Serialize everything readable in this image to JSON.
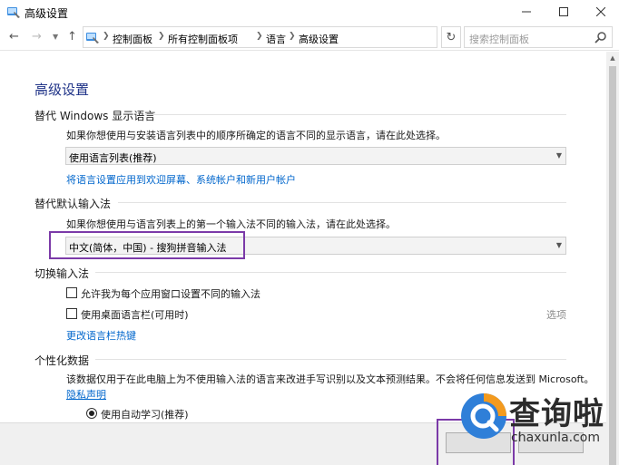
{
  "window": {
    "title": "高级设置",
    "icons": {
      "app": "control-panel-icon",
      "minimize": "minimize-icon",
      "maximize": "maximize-icon",
      "close": "close-icon"
    }
  },
  "address_bar": {
    "breadcrumbs": [
      "控制面板",
      "所有控制面板项",
      "语言",
      "高级设置"
    ],
    "search_placeholder": "搜索控制面板",
    "icons": {
      "back": "back-arrow-icon",
      "forward": "forward-arrow-icon",
      "up": "up-arrow-icon",
      "refresh": "refresh-icon",
      "search": "search-icon"
    }
  },
  "main": {
    "title": "高级设置",
    "display_language": {
      "heading": "替代 Windows 显示语言",
      "description": "如果你想使用与安装语言列表中的顺序所确定的语言不同的显示语言，请在此处选择。",
      "selected": "使用语言列表(推荐)",
      "link": "将语言设置应用到欢迎屏幕、系统帐户和新用户帐户"
    },
    "input_method": {
      "heading": "替代默认输入法",
      "description": "如果你想使用与语言列表上的第一个输入法不同的输入法，请在此处选择。",
      "selected": "中文(简体，中国) - 搜狗拼音输入法"
    },
    "switch_input": {
      "heading": "切换输入法",
      "option1": "允许我为每个应用窗口设置不同的输入法",
      "option2": "使用桌面语言栏(可用时)",
      "options_link": "选项",
      "hotkeys_link": "更改语言栏热键"
    },
    "personalization": {
      "heading": "个性化数据",
      "description": "该数据仅用于在此电脑上为不使用输入法的语言来改进手写识别以及文本预测结果。不会将任何信息发送到 Microsoft。",
      "privacy_link": "隐私声明",
      "radio_label": "使用自动学习(推荐)"
    }
  },
  "watermark": {
    "text": "查询啦",
    "sub": "chaxunla.com"
  },
  "colors": {
    "title_blue": "#1e3287",
    "link_blue": "#0066cc",
    "highlight_purple": "#7b3aa8",
    "watermark_blue": "#2f7fd8",
    "watermark_orange": "#f39a1e"
  }
}
